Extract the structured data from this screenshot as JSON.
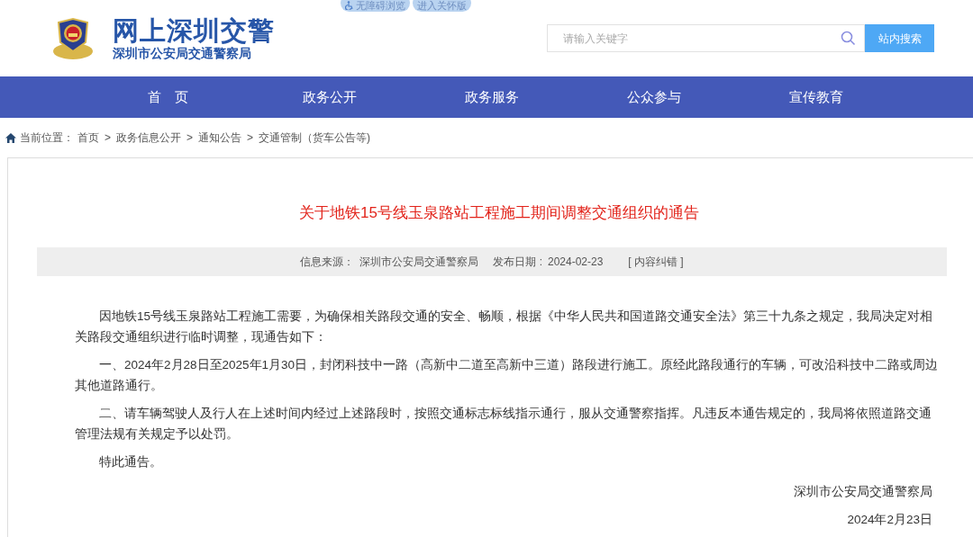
{
  "top_links": [
    {
      "label": "无障碍浏览",
      "kind": "accessible"
    },
    {
      "label": "进入关怀版",
      "kind": "plain"
    }
  ],
  "header": {
    "title": "网上深圳交警",
    "subtitle": "深圳市公安局交通警察局"
  },
  "search": {
    "placeholder": "请输入关键字",
    "button": "站内搜索"
  },
  "nav": [
    "首　页",
    "政务公开",
    "政务服务",
    "公众参与",
    "宣传教育"
  ],
  "breadcrumb": {
    "label": "当前位置：",
    "items": [
      {
        "kind": "link",
        "text": "首页"
      },
      {
        "kind": "sep",
        "text": ">"
      },
      {
        "kind": "link",
        "text": "政务信息公开"
      },
      {
        "kind": "sep",
        "text": ">"
      },
      {
        "kind": "link",
        "text": "通知公告"
      },
      {
        "kind": "sep",
        "text": ">"
      },
      {
        "kind": "link",
        "text": "交通管制（货车公告等)"
      }
    ]
  },
  "article": {
    "title": "关于地铁15号线玉泉路站工程施工期间调整交通组织的通告",
    "meta": {
      "source_label": "信息来源：",
      "source": "深圳市公安局交通警察局",
      "date_label": "发布日期 :",
      "date": "2024-02-23",
      "report": "[ 内容纠错 ]"
    },
    "paragraphs": [
      "因地铁15号线玉泉路站工程施工需要，为确保相关路段交通的安全、畅顺，根据《中华人民共和国道路交通安全法》第三十九条之规定，我局决定对相关路段交通组织进行临时调整，现通告如下：",
      "一、2024年2月28日至2025年1月30日，封闭科技中一路（高新中二道至高新中三道）路段进行施工。原经此路段通行的车辆，可改沿科技中二路或周边其他道路通行。",
      "二、请车辆驾驶人及行人在上述时间内经过上述路段时，按照交通标志标线指示通行，服从交通警察指挥。凡违反本通告规定的，我局将依照道路交通管理法规有关规定予以处罚。",
      "特此通告。"
    ],
    "signature": "深圳市公安局交通警察局",
    "sign_date": "2024年2月23日"
  }
}
